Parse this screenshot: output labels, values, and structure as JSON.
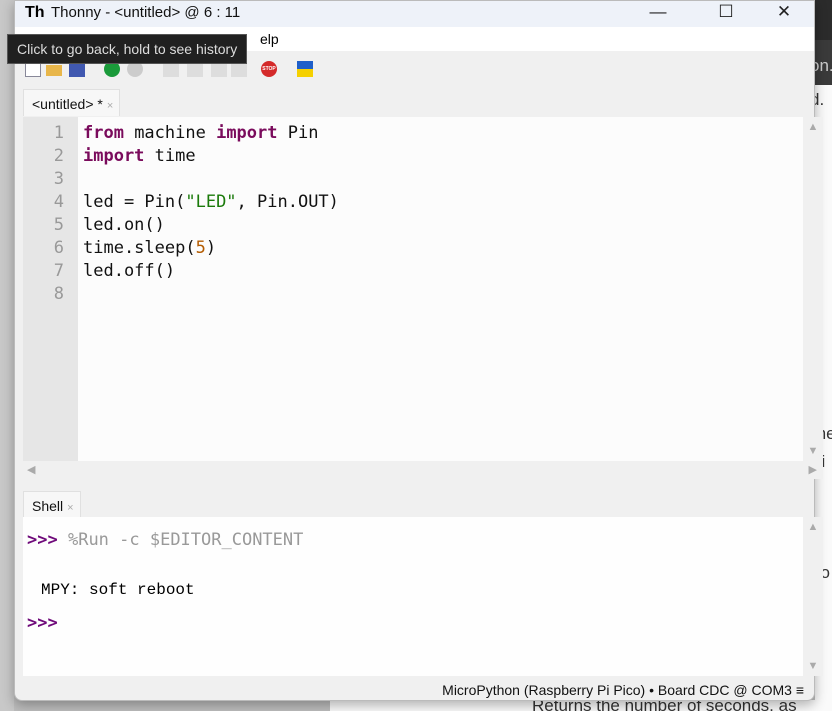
{
  "window": {
    "title": "Thonny  -  <untitled>  @  6 : 11",
    "logo": "Th",
    "minimize": "—",
    "maximize": "☐",
    "close": "✕"
  },
  "menu": {
    "help_partial": "elp"
  },
  "tooltip": "Click to go back, hold to see history",
  "toolbar": {
    "icons": [
      "new-file-icon",
      "open-file-icon",
      "save-icon",
      "run-icon",
      "debug-icon",
      "step-over-icon",
      "step-into-icon",
      "step-out-icon",
      "resume-icon",
      "stop-icon",
      "ukraine-flag-icon"
    ],
    "stop_label": "STOP"
  },
  "editor": {
    "tab_label": "<untitled> *",
    "tab_close": "×",
    "lines": [
      "1",
      "2",
      "3",
      "4",
      "5",
      "6",
      "7",
      "8"
    ]
  },
  "shell": {
    "tab_label": "Shell",
    "tab_close": "×",
    "prompt": ">>>",
    "command": "%Run -c $EDITOR_CONTENT",
    "output": "MPY: soft reboot"
  },
  "status": {
    "interpreter": "MicroPython (Raspberry Pi Pico)",
    "sep": "•",
    "port": "Board CDC @ COM3",
    "menu": "≡"
  },
  "background": {
    "frag1": "on.",
    "frag2": "d.",
    "frag3": "me",
    "frag4": "hi",
    "frag5": "co",
    "frag6": "Returns the number of seconds, as"
  },
  "colors": {
    "keyword": "#7a0b5c",
    "string": "#1a7a0a",
    "number": "#b35b00",
    "prompt": "#6f0a7a"
  }
}
